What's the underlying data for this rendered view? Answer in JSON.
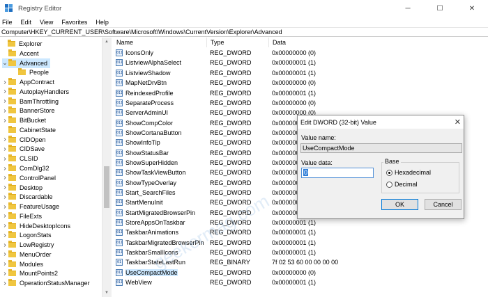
{
  "window": {
    "title": "Registry Editor",
    "minimize": "─",
    "maximize": "☐",
    "close": "✕"
  },
  "menu": [
    "File",
    "Edit",
    "View",
    "Favorites",
    "Help"
  ],
  "address": "Computer\\HKEY_CURRENT_USER\\Software\\Microsoft\\Windows\\CurrentVersion\\Explorer\\Advanced",
  "tree": [
    {
      "label": "Explorer",
      "expander": "",
      "level": 0
    },
    {
      "label": "Accent",
      "expander": "",
      "level": 1
    },
    {
      "label": "Advanced",
      "expander": "expanded",
      "level": 1,
      "selected": true
    },
    {
      "label": "People",
      "expander": "",
      "level": 2
    },
    {
      "label": "AppContract",
      "expander": "collapsed",
      "level": 1
    },
    {
      "label": "AutoplayHandlers",
      "expander": "collapsed",
      "level": 1
    },
    {
      "label": "BamThrottling",
      "expander": "collapsed",
      "level": 1
    },
    {
      "label": "BannerStore",
      "expander": "collapsed",
      "level": 1
    },
    {
      "label": "BitBucket",
      "expander": "collapsed",
      "level": 1
    },
    {
      "label": "CabinetState",
      "expander": "",
      "level": 1
    },
    {
      "label": "CIDOpen",
      "expander": "collapsed",
      "level": 1
    },
    {
      "label": "CIDSave",
      "expander": "collapsed",
      "level": 1
    },
    {
      "label": "CLSID",
      "expander": "collapsed",
      "level": 1
    },
    {
      "label": "ComDlg32",
      "expander": "collapsed",
      "level": 1
    },
    {
      "label": "ControlPanel",
      "expander": "collapsed",
      "level": 1
    },
    {
      "label": "Desktop",
      "expander": "collapsed",
      "level": 1
    },
    {
      "label": "Discardable",
      "expander": "collapsed",
      "level": 1
    },
    {
      "label": "FeatureUsage",
      "expander": "collapsed",
      "level": 1
    },
    {
      "label": "FileExts",
      "expander": "collapsed",
      "level": 1
    },
    {
      "label": "HideDesktopIcons",
      "expander": "collapsed",
      "level": 1
    },
    {
      "label": "LogonStats",
      "expander": "collapsed",
      "level": 1
    },
    {
      "label": "LowRegistry",
      "expander": "collapsed",
      "level": 1
    },
    {
      "label": "MenuOrder",
      "expander": "collapsed",
      "level": 1
    },
    {
      "label": "Modules",
      "expander": "collapsed",
      "level": 1
    },
    {
      "label": "MountPoints2",
      "expander": "collapsed",
      "level": 1
    },
    {
      "label": "OperationStatusManager",
      "expander": "collapsed",
      "level": 1
    }
  ],
  "columns": {
    "name": "Name",
    "type": "Type",
    "data": "Data"
  },
  "values": [
    {
      "name": "IconsOnly",
      "type": "REG_DWORD",
      "data": "0x00000000 (0)",
      "icon": "dword-icon"
    },
    {
      "name": "ListviewAlphaSelect",
      "type": "REG_DWORD",
      "data": "0x00000001 (1)",
      "icon": "dword-icon"
    },
    {
      "name": "ListviewShadow",
      "type": "REG_DWORD",
      "data": "0x00000001 (1)",
      "icon": "dword-icon"
    },
    {
      "name": "MapNetDrvBtn",
      "type": "REG_DWORD",
      "data": "0x00000000 (0)",
      "icon": "dword-icon"
    },
    {
      "name": "ReindexedProfile",
      "type": "REG_DWORD",
      "data": "0x00000001 (1)",
      "icon": "dword-icon"
    },
    {
      "name": "SeparateProcess",
      "type": "REG_DWORD",
      "data": "0x00000000 (0)",
      "icon": "dword-icon"
    },
    {
      "name": "ServerAdminUI",
      "type": "REG_DWORD",
      "data": "0x00000000 (0)",
      "icon": "dword-icon"
    },
    {
      "name": "ShowCompColor",
      "type": "REG_DWORD",
      "data": "0x0000000",
      "icon": "dword-icon"
    },
    {
      "name": "ShowCortanaButton",
      "type": "REG_DWORD",
      "data": "0x0000000",
      "icon": "dword-icon"
    },
    {
      "name": "ShowInfoTip",
      "type": "REG_DWORD",
      "data": "0x0000000",
      "icon": "dword-icon"
    },
    {
      "name": "ShowStatusBar",
      "type": "REG_DWORD",
      "data": "0x0000000",
      "icon": "dword-icon"
    },
    {
      "name": "ShowSuperHidden",
      "type": "REG_DWORD",
      "data": "0x0000000",
      "icon": "dword-icon"
    },
    {
      "name": "ShowTaskViewButton",
      "type": "REG_DWORD",
      "data": "0x0000000",
      "icon": "dword-icon"
    },
    {
      "name": "ShowTypeOverlay",
      "type": "REG_DWORD",
      "data": "0x0000000",
      "icon": "dword-icon"
    },
    {
      "name": "Start_SearchFiles",
      "type": "REG_DWORD",
      "data": "0x0000000",
      "icon": "dword-icon"
    },
    {
      "name": "StartMenuInit",
      "type": "REG_DWORD",
      "data": "0x0000000",
      "icon": "dword-icon"
    },
    {
      "name": "StartMigratedBrowserPin",
      "type": "REG_DWORD",
      "data": "0x0000000",
      "icon": "dword-icon"
    },
    {
      "name": "StoreAppsOnTaskbar",
      "type": "REG_DWORD",
      "data": "0x00000001 (1)",
      "icon": "dword-icon"
    },
    {
      "name": "TaskbarAnimations",
      "type": "REG_DWORD",
      "data": "0x00000001 (1)",
      "icon": "dword-icon"
    },
    {
      "name": "TaskbarMigratedBrowserPin",
      "type": "REG_DWORD",
      "data": "0x00000001 (1)",
      "icon": "dword-icon"
    },
    {
      "name": "TaskbarSmallIcons",
      "type": "REG_DWORD",
      "data": "0x00000001 (1)",
      "icon": "dword-icon"
    },
    {
      "name": "TaskbarStateLastRun",
      "type": "REG_BINARY",
      "data": "7f 02 53 60 00 00 00 00",
      "icon": "binary-icon"
    },
    {
      "name": "UseCompactMode",
      "type": "REG_DWORD",
      "data": "0x00000000 (0)",
      "icon": "dword-icon",
      "selected": true
    },
    {
      "name": "WebView",
      "type": "REG_DWORD",
      "data": "0x00000001 (1)",
      "icon": "dword-icon"
    }
  ],
  "dialog": {
    "title": "Edit DWORD (32-bit) Value",
    "value_name_label": "Value name:",
    "value_name": "UseCompactMode",
    "value_data_label": "Value data:",
    "value_data": "0",
    "base_label": "Base",
    "hex_label": "Hexadecimal",
    "dec_label": "Decimal",
    "base_selected": "Hexadecimal",
    "ok_label": "OK",
    "cancel_label": "Cancel",
    "close": "✕"
  },
  "watermark": "geekermag.com",
  "colors": {
    "selection": "#cce8ff",
    "accent": "#0078d7",
    "folder": "#f0c640"
  }
}
